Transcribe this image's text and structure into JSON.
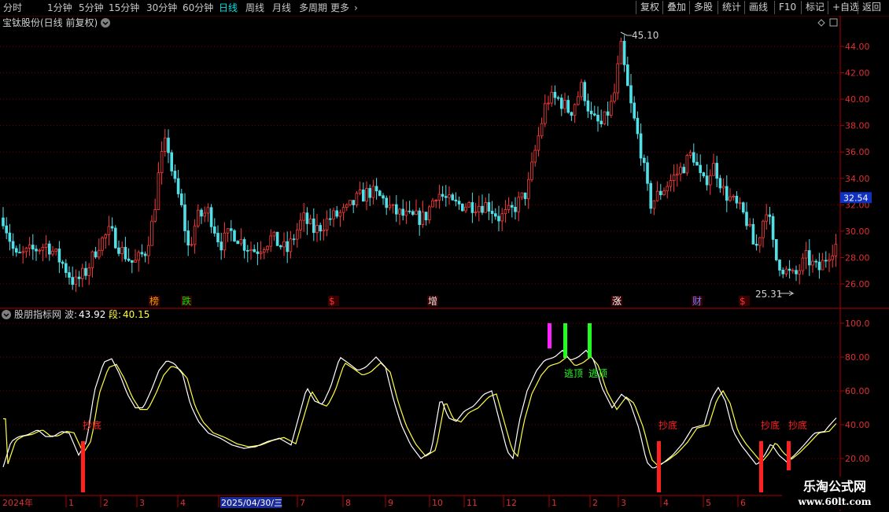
{
  "toolbar": {
    "periods": [
      {
        "label": "分时",
        "active": false
      },
      {
        "label": "1分钟",
        "active": false
      },
      {
        "label": "5分钟",
        "active": false
      },
      {
        "label": "15分钟",
        "active": false
      },
      {
        "label": "30分钟",
        "active": false
      },
      {
        "label": "60分钟",
        "active": false
      },
      {
        "label": "日线",
        "active": true
      },
      {
        "label": "周线",
        "active": false
      },
      {
        "label": "月线",
        "active": false
      },
      {
        "label": "多周期",
        "active": false
      },
      {
        "label": "更多",
        "active": false
      }
    ],
    "right_buttons": [
      "复权",
      "叠加",
      "多股",
      "统计",
      "画线",
      "F10",
      "标记",
      "+自选",
      "返回"
    ]
  },
  "main_panel": {
    "title": "宝钛股份(日线 前复权)",
    "y_axis_labels": [
      "44.00",
      "42.00",
      "40.00",
      "38.00",
      "36.00",
      "34.00",
      "32.00",
      "30.00",
      "28.00",
      "26.00"
    ],
    "current_price": "32.54",
    "high_marker": "45.10",
    "low_marker": "25.31",
    "event_markers": [
      {
        "text": "榜",
        "color": "#e0a000"
      },
      {
        "text": "跌",
        "color": "#00e000"
      },
      {
        "text": "$",
        "color": "#ff3030"
      },
      {
        "text": "增",
        "color": "#e0e0e0"
      },
      {
        "text": "涨",
        "color": "#ffffff"
      },
      {
        "text": "财",
        "color": "#6080ff"
      },
      {
        "text": "$",
        "color": "#ff3030"
      }
    ]
  },
  "indicator_panel": {
    "name": "股朋指标网",
    "wave_label": "波:",
    "wave_value": "43.92",
    "seg_label": "段:",
    "seg_value": "40.15",
    "y_axis_labels": [
      "100.0",
      "80.00",
      "60.00",
      "40.00",
      "20.00"
    ],
    "signals": [
      "抄底",
      "逃顶",
      "逃顶",
      "抄底",
      "抄底",
      "抄底"
    ]
  },
  "x_axis": {
    "labels": [
      "2024年",
      "1",
      "2",
      "3",
      "4",
      "2025/04/30/三",
      "7",
      "8",
      "9",
      "10",
      "11",
      "12",
      "1",
      "2",
      "3",
      "4",
      "5",
      "6"
    ]
  },
  "watermark": {
    "title": "乐淘公式网",
    "url": "www.60lt.com"
  },
  "colors": {
    "up": "#ff3c3c",
    "down": "#4fe0e8",
    "wave": "#ffffff",
    "seg": "#ffff40",
    "grid": "#7a0000",
    "border": "#b00000"
  }
}
